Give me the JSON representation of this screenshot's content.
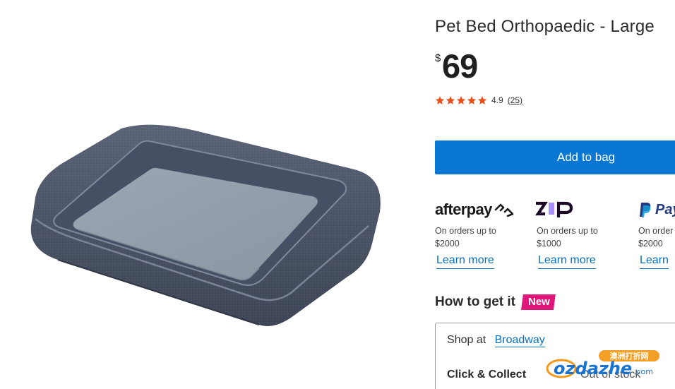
{
  "product": {
    "title": "Pet Bed Orthopaedic - Large",
    "price_currency": "$",
    "price_amount": "69",
    "rating_value": "4.9",
    "review_count": "(25)",
    "stars": 5,
    "star_color": "#e8501a"
  },
  "actions": {
    "add_to_bag_label": "Add to bag",
    "add_to_bag_color": "#0a77d4"
  },
  "payments": [
    {
      "logo": "afterpay",
      "desc_line1": "On orders up to",
      "desc_line2": "$2000",
      "link": "Learn more"
    },
    {
      "logo": "zip",
      "desc_line1": "On orders up to",
      "desc_line2": "$1000",
      "link": "Learn more"
    },
    {
      "logo": "PayPal",
      "logo_text": "Pay",
      "desc_line1": "On order",
      "desc_line2": "$2000",
      "link": "Learn"
    }
  ],
  "fulfilment": {
    "heading": "How to get it",
    "badge": "New",
    "badge_color": "#e0167a",
    "shop_at_label": "Shop at",
    "store_name": "Broadway",
    "click_collect_label": "Click & Collect",
    "click_collect_status": "Out of stock"
  },
  "watermark": {
    "text_top": "澳洲打折网",
    "text_brand": "ozdazhe",
    "text_suffix": ".com"
  }
}
